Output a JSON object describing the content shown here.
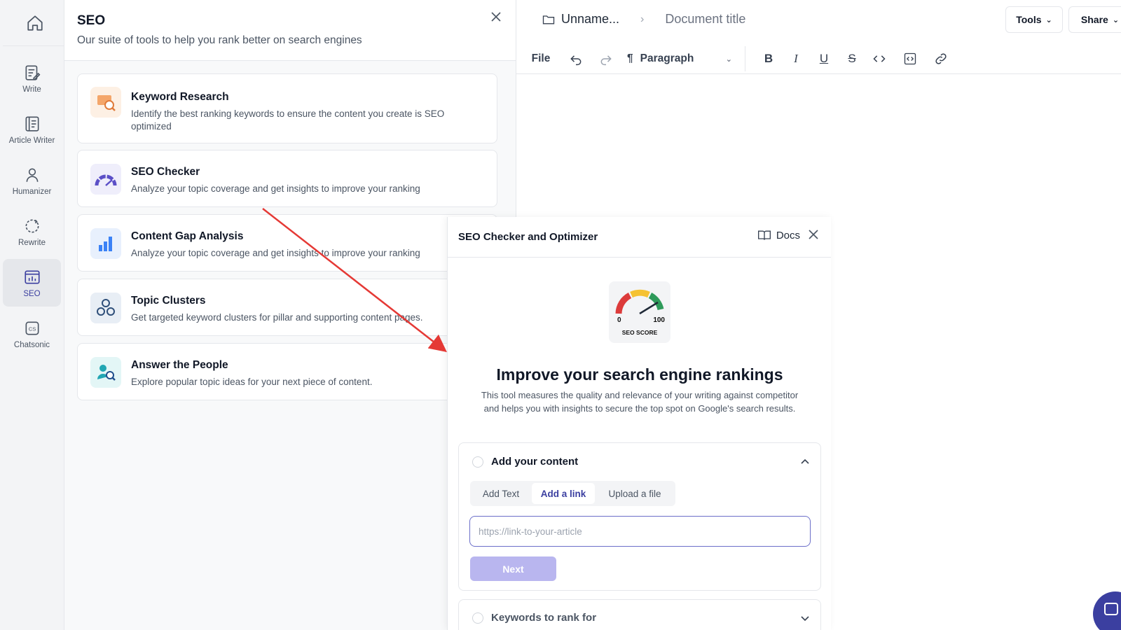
{
  "rail": {
    "items": [
      {
        "label": "Write",
        "icon": "write-icon"
      },
      {
        "label": "Article Writer",
        "icon": "article-icon"
      },
      {
        "label": "Humanizer",
        "icon": "person-icon"
      },
      {
        "label": "Rewrite",
        "icon": "rewrite-icon"
      },
      {
        "label": "SEO",
        "icon": "seo-chart-icon",
        "active": true
      },
      {
        "label": "Chatsonic",
        "icon": "chatsonic-icon"
      }
    ]
  },
  "seo_panel": {
    "title": "SEO",
    "subtitle": "Our suite of tools to help you rank better on search engines",
    "tools": [
      {
        "title": "Keyword Research",
        "desc": "Identify the best ranking keywords to ensure the content you create is SEO optimized"
      },
      {
        "title": "SEO Checker",
        "desc": "Analyze your topic coverage and get insights to improve your ranking"
      },
      {
        "title": "Content Gap Analysis",
        "desc": "Analyze your topic coverage and get insights to improve your ranking"
      },
      {
        "title": "Topic Clusters",
        "desc": "Get targeted keyword clusters for pillar and supporting content pages."
      },
      {
        "title": "Answer the People",
        "desc": "Explore popular topic ideas for your next piece of content."
      }
    ]
  },
  "editor": {
    "folder": "Unname...",
    "doc_title": "Document title",
    "tools_label": "Tools",
    "share_label": "Share",
    "file_label": "File",
    "paragraph_label": "Paragraph"
  },
  "modal": {
    "title": "SEO Checker and Optimizer",
    "docs_label": "Docs",
    "gauge": {
      "min": "0",
      "max": "100",
      "caption": "SEO SCORE"
    },
    "heading": "Improve your search engine rankings",
    "description": "This tool measures the quality and relevance of your writing against competitor and helps you with insights to secure the top spot on Google's search results.",
    "section1": {
      "title": "Add your content",
      "tabs": [
        "Add Text",
        "Add a link",
        "Upload a file"
      ],
      "active_tab": "Add a link",
      "input_placeholder": "https://link-to-your-article",
      "next_label": "Next"
    },
    "section2": {
      "title": "Keywords to rank for"
    }
  },
  "colors": {
    "accent": "#3b3fa0",
    "arrow": "#e53935",
    "next_disabled": "#b9b6ef"
  }
}
